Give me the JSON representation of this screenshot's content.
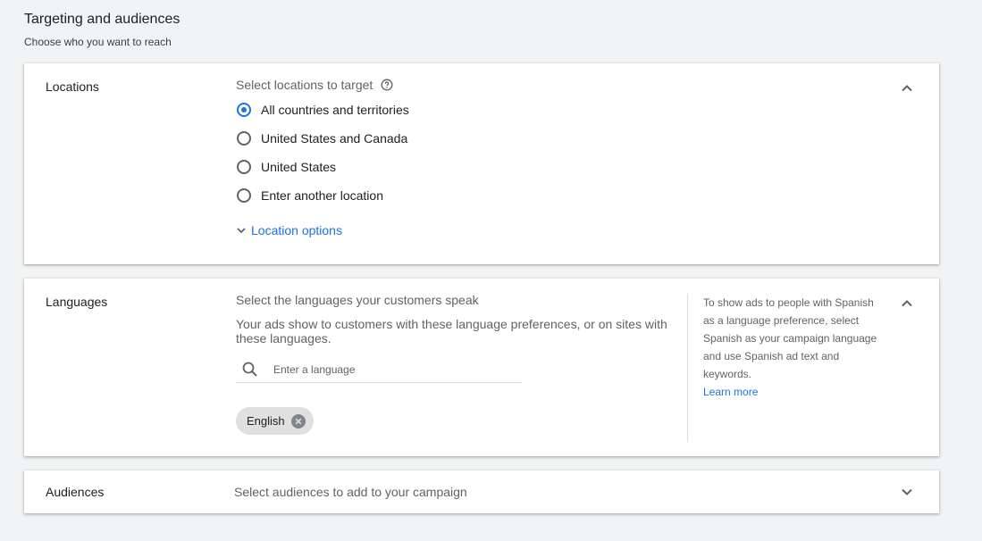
{
  "header": {
    "title": "Targeting and audiences",
    "subtitle": "Choose who you want to reach"
  },
  "locations": {
    "title": "Locations",
    "prompt": "Select locations to target",
    "help_icon": "help-circle-icon",
    "options": [
      {
        "label": "All countries and territories",
        "checked": true
      },
      {
        "label": "United States and Canada",
        "checked": false
      },
      {
        "label": "United States",
        "checked": false
      },
      {
        "label": "Enter another location",
        "checked": false
      }
    ],
    "more_options_label": "Location options",
    "collapse_icon": "chevron-up-icon"
  },
  "languages": {
    "title": "Languages",
    "prompt": "Select the languages your customers speak",
    "description": "Your ads show to customers with these language preferences, or on sites with these languages.",
    "search_placeholder": "Enter a language",
    "search_value": "",
    "selected": [
      "English"
    ],
    "side_note": "To show ads to people with Spanish as a language preference, select Spanish as your campaign language and use Spanish ad text and keywords.",
    "learn_more": "Learn more",
    "collapse_icon": "chevron-up-icon"
  },
  "audiences": {
    "title": "Audiences",
    "prompt": "Select audiences to add to your campaign",
    "expand_icon": "chevron-down-icon"
  },
  "colors": {
    "accent": "#1a73e8",
    "background": "#f1f3f4",
    "text_secondary": "#5f6368"
  }
}
